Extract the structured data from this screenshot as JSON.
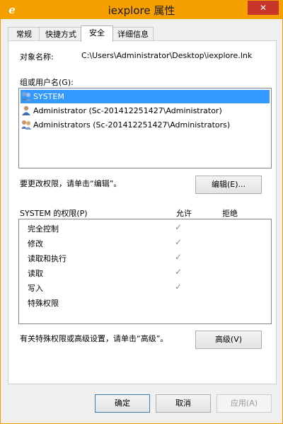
{
  "window": {
    "title": "iexplore 属性",
    "close_glyph": "✕",
    "app_icon": "e"
  },
  "tabs": [
    {
      "label": "常规"
    },
    {
      "label": "快捷方式"
    },
    {
      "label": "安全"
    },
    {
      "label": "详细信息"
    }
  ],
  "object": {
    "label": "对象名称:",
    "value": "C:\\Users\\Administrator\\Desktop\\iexplore.lnk"
  },
  "groups": {
    "label": "组或用户名(G):",
    "items": [
      {
        "name": "SYSTEM",
        "icon": "group-users-icon"
      },
      {
        "name": "Administrator (Sc-201412251427\\Administrator)",
        "icon": "user-icon"
      },
      {
        "name": "Administrators (Sc-201412251427\\Administrators)",
        "icon": "group-users-icon"
      }
    ],
    "selected_index": 0
  },
  "edit": {
    "hint": "要更改权限，请单击“编辑”。",
    "button": "编辑(E)..."
  },
  "permissions": {
    "title": "SYSTEM 的权限(P)",
    "allow_header": "允许",
    "deny_header": "拒绝",
    "check_glyph": "✓",
    "items": [
      {
        "name": "完全控制",
        "allow": true
      },
      {
        "name": "修改",
        "allow": true
      },
      {
        "name": "读取和执行",
        "allow": true
      },
      {
        "name": "读取",
        "allow": true
      },
      {
        "name": "写入",
        "allow": true
      },
      {
        "name": "特殊权限",
        "allow": false
      }
    ]
  },
  "advanced": {
    "hint": "有关特殊权限或高级设置，请单击“高级”。",
    "button": "高级(V)"
  },
  "footer": {
    "ok": "确定",
    "cancel": "取消",
    "apply": "应用(A)"
  },
  "colors": {
    "titlebar": "#f5a000",
    "selection": "#3399ff",
    "close": "#c7352b"
  }
}
